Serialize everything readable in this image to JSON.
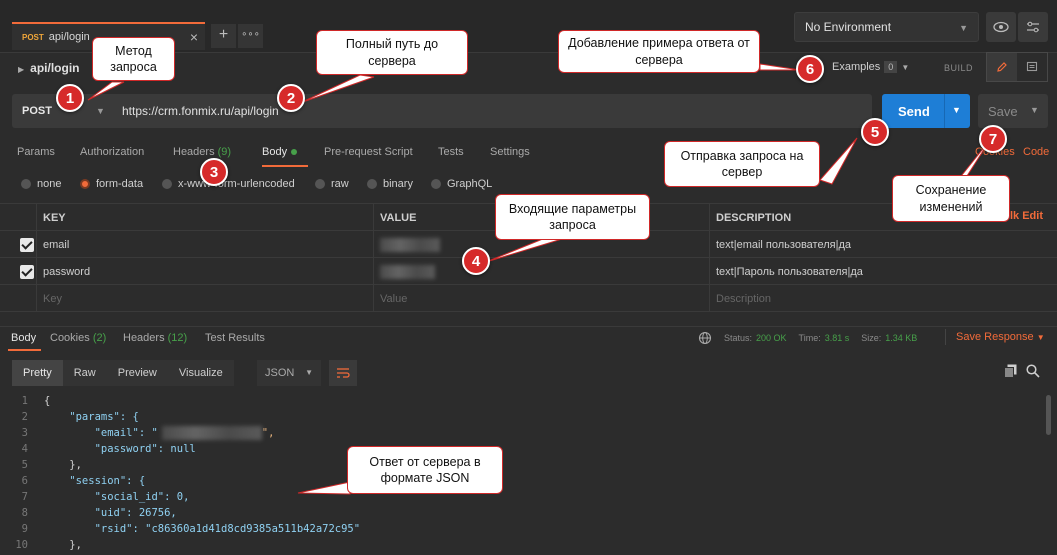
{
  "tabs": [
    {
      "method": "POST",
      "name": "api/login"
    }
  ],
  "tab_close": "×",
  "tab_new": "+",
  "tab_more": "∘∘∘",
  "environment": {
    "selected": "No Environment"
  },
  "breadcrumb": {
    "name": "api/login"
  },
  "examples": {
    "label": "Examples",
    "count": "0"
  },
  "build_label": "BUILD",
  "request": {
    "method": "POST",
    "url": "https://crm.fonmix.ru/api/login"
  },
  "send_label": "Send",
  "save_label": "Save",
  "request_tabs": {
    "params": "Params",
    "authorization": "Authorization",
    "headers": "Headers",
    "headers_count": "(9)",
    "body": "Body",
    "pre_request": "Pre-request Script",
    "tests": "Tests",
    "settings": "Settings",
    "cookies": "Cookies",
    "code": "Code"
  },
  "body_types": [
    "none",
    "form-data",
    "x-www-form-urlencoded",
    "raw",
    "binary",
    "GraphQL"
  ],
  "table": {
    "headers": {
      "key": "KEY",
      "value": "VALUE",
      "description": "DESCRIPTION"
    },
    "bulk_edit": "Bulk Edit",
    "rows": [
      {
        "key": "email",
        "description": "text|email пользователя|да"
      },
      {
        "key": "password",
        "description": "text|Пароль пользователя|да"
      }
    ],
    "placeholder": {
      "key": "Key",
      "value": "Value",
      "description": "Description"
    }
  },
  "response_tabs": {
    "body": "Body",
    "cookies": "Cookies",
    "cookies_count": "(2)",
    "headers": "Headers",
    "headers_count": "(12)",
    "test_results": "Test Results"
  },
  "response_status": {
    "status_label": "Status:",
    "status": "200 OK",
    "time_label": "Time:",
    "time": "3.81 s",
    "size_label": "Size:",
    "size": "1.34 KB",
    "save_response": "Save Response"
  },
  "response_view": {
    "pretty": "Pretty",
    "raw": "Raw",
    "preview": "Preview",
    "visualize": "Visualize",
    "format": "JSON"
  },
  "code_lines": [
    "{",
    "    \"params\": {",
    "        \"email\": \"",
    "        \"password\": null",
    "    },",
    "    \"session\": {",
    "        \"social_id\": 0,",
    "        \"uid\": 26756,",
    "        \"rsid\": \"c86360a1d41d8cd9385a511b42a72c95\"",
    "    },"
  ],
  "line_numbers": [
    "1",
    "2",
    "3",
    "4",
    "5",
    "6",
    "7",
    "8",
    "9",
    "10"
  ],
  "callouts": {
    "method": "Метод запроса",
    "full_path": "Полный путь до сервера",
    "example": "Добавление примера ответа от сервера",
    "send": "Отправка запроса на сервер",
    "save": "Сохранение изменений",
    "params": "Входящие параметры запроса",
    "response": "Ответ от сервера в формате JSON"
  },
  "badges": [
    "1",
    "2",
    "3",
    "4",
    "5",
    "6",
    "7"
  ],
  "colors": {
    "accent": "#f26b3a",
    "send": "#1e7ed6",
    "callout_border": "#d02828",
    "badge": "#d62a2a",
    "status_ok": "#47a04a"
  }
}
